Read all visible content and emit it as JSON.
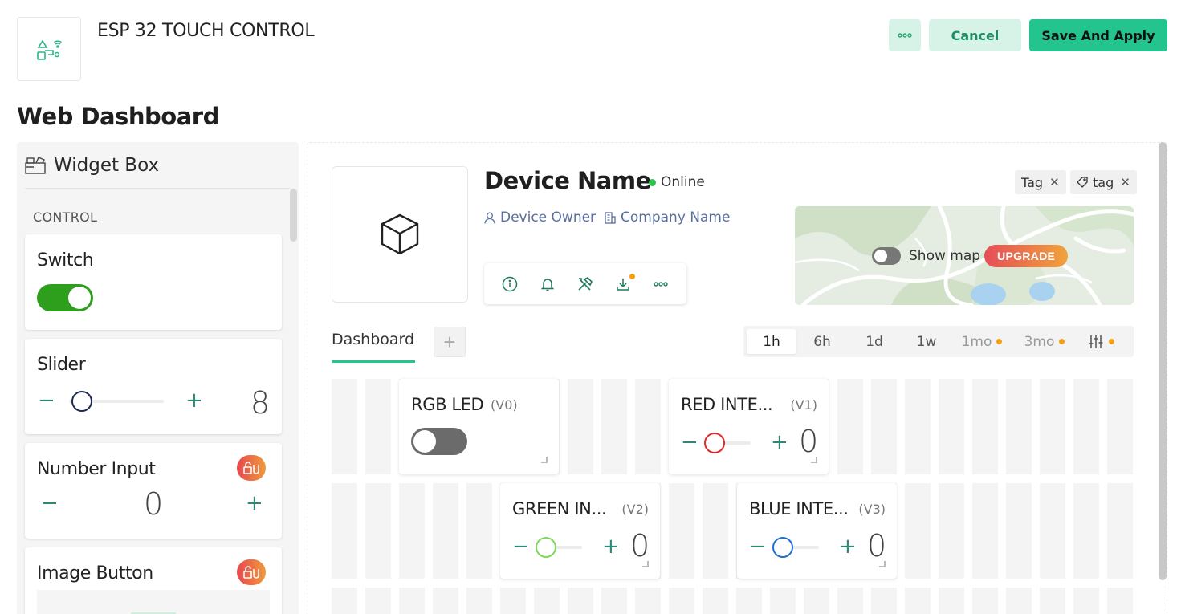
{
  "header": {
    "app_title": "ESP 32 TOUCH CONTROL",
    "logo_icon": "iot-device-icon",
    "more_icon": "more-horizontal-icon",
    "cancel_label": "Cancel",
    "save_label": "Save And Apply"
  },
  "section_title": "Web Dashboard",
  "widget_box": {
    "title": "Widget Box",
    "category": "CONTROL",
    "widgets": [
      {
        "label": "Switch",
        "state": "on"
      },
      {
        "label": "Slider",
        "value": "8",
        "minus": "−",
        "plus": "+"
      },
      {
        "label": "Number Input",
        "value": "0",
        "minus": "−",
        "plus": "+",
        "locked": true
      },
      {
        "label": "Image Button",
        "locked": true
      }
    ]
  },
  "device": {
    "name": "Device Name",
    "status": "Online",
    "owner": "Device Owner",
    "company": "Company Name",
    "tags": [
      "Tag",
      "tag"
    ],
    "actions": [
      "info-icon",
      "bell-icon",
      "tools-icon",
      "download-icon",
      "more-horizontal-icon"
    ]
  },
  "map": {
    "show_map_label": "Show map",
    "upgrade_label": "UPGRADE"
  },
  "tabs": {
    "dashboard_label": "Dashboard",
    "add_label": "+"
  },
  "time_range": {
    "options": [
      "1h",
      "6h",
      "1d",
      "1w",
      "1mo",
      "3mo"
    ],
    "selected": "1h"
  },
  "tiles": [
    {
      "name": "RGB LED",
      "pin": "(V0)",
      "type": "switch",
      "state": "off"
    },
    {
      "name": "RED INTE...",
      "pin": "(V1)",
      "type": "slider",
      "value": "0",
      "color": "#e02a2a",
      "level": 0
    },
    {
      "name": "GREEN IN...",
      "pin": "(V2)",
      "type": "slider",
      "value": "0",
      "color": "#7ed957",
      "level": 0
    },
    {
      "name": "BLUE INTE...",
      "pin": "(V3)",
      "type": "slider",
      "value": "0",
      "color": "#1f6fd1",
      "level": 0
    }
  ],
  "colors": {
    "accent": "#23c48e",
    "online": "#2bc44d",
    "switch_on": "#2e9f1c",
    "link": "#5a6f9e"
  }
}
